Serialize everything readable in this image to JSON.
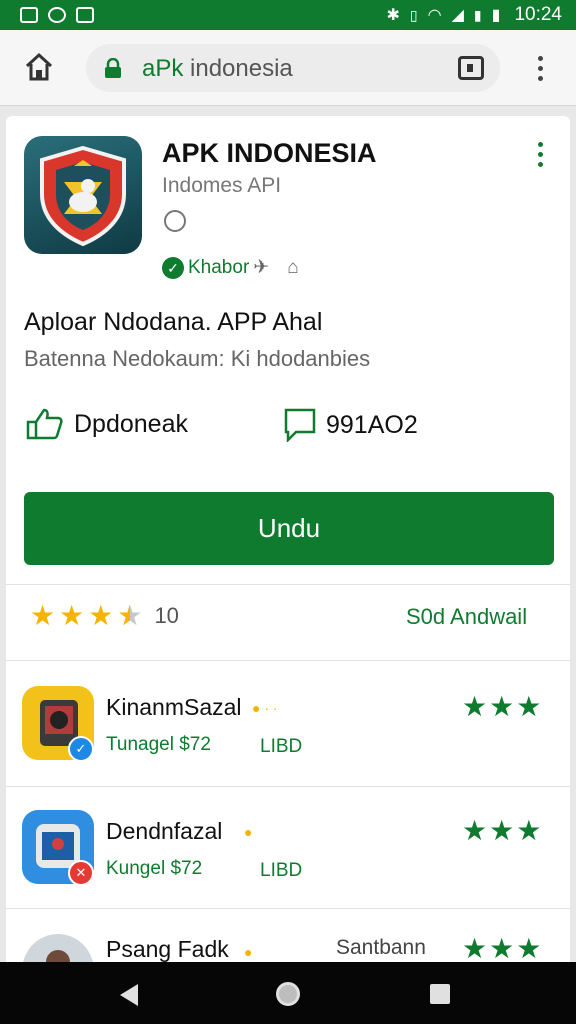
{
  "status": {
    "time": "10:24"
  },
  "browser": {
    "url_highlight": "aPk",
    "url_rest": " indonesia"
  },
  "app": {
    "title": "APK INDONESIA",
    "subtitle": "Indomes API",
    "verified_label": "Khabor",
    "description_line1": "Aploar Ndodana. APP Ahal",
    "description_line2": "Batenna Nedokaum: Ki hdodanbies",
    "stat_likes": "Dpdoneak",
    "stat_comments": "991AO2",
    "download_label": "Undu"
  },
  "rating": {
    "value": 3.5,
    "count": "10",
    "more_label": "S0d  Andwail"
  },
  "list": [
    {
      "name": "KinanmSazal",
      "sub": "Tunagel $72",
      "side": "LIBD",
      "rating": 3,
      "thumb_color": "#f2c21b",
      "badge_color": "#1e88e5",
      "badge_icon": "check-icon"
    },
    {
      "name": "Dendnfazal",
      "sub": "Kungel $72",
      "side": "LIBD",
      "rating": 3,
      "thumb_color": "#2f8ee0",
      "badge_color": "#e53935",
      "badge_icon": "x-icon"
    },
    {
      "name": "Psang Fadk",
      "sub": "",
      "side": "Santbann",
      "rating": 3,
      "thumb_color": "#cfd6dc"
    }
  ],
  "colors": {
    "brand": "#0f7b2e",
    "star": "#f5b400"
  }
}
